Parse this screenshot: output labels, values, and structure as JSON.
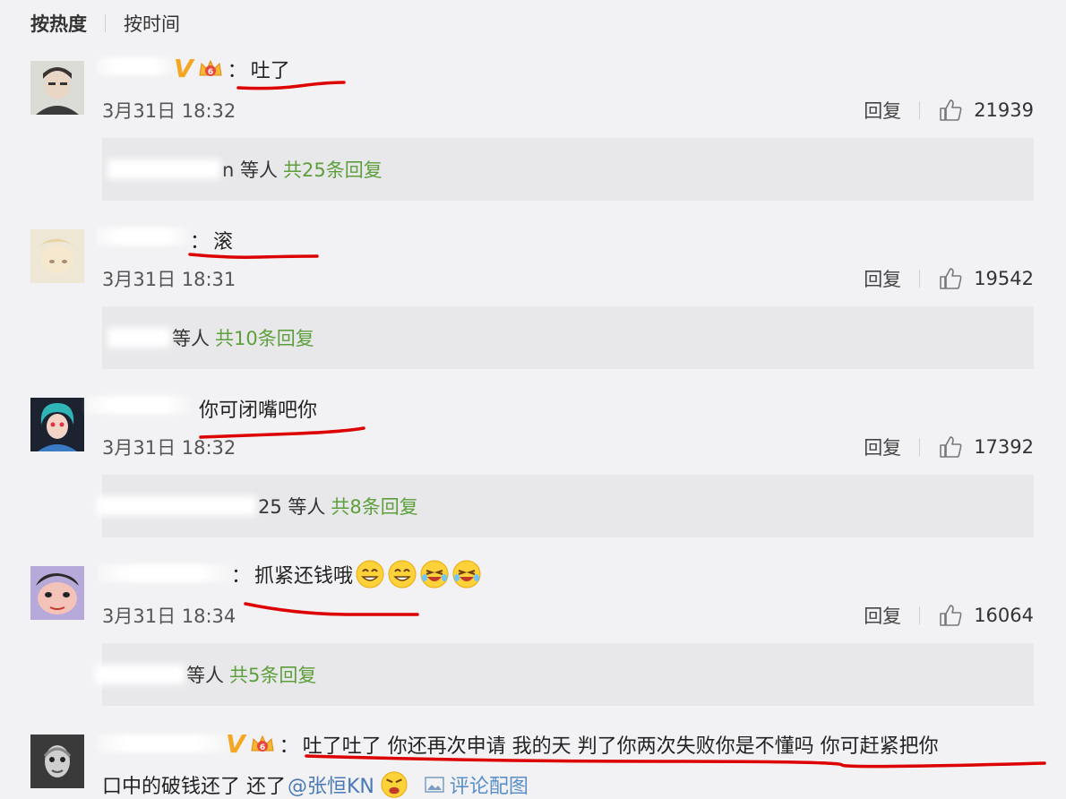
{
  "sort": {
    "hot": "按热度",
    "time": "按时间"
  },
  "actions": {
    "reply": "回复"
  },
  "colors": {
    "background": "#f2f2f4",
    "reply_box": "#e8e8ea",
    "green": "#5d9f3c",
    "red_line": "#dd0000",
    "vip": "#f5a623"
  },
  "comments": [
    {
      "colon": "：",
      "text": "吐了",
      "time": "3月31日 18:32",
      "likes": "21939",
      "reply_prefix": "n 等人",
      "reply_count": "共25条回复"
    },
    {
      "colon": "：",
      "text": "滚",
      "time": "3月31日 18:31",
      "likes": "19542",
      "reply_prefix": "等人",
      "reply_count": "共10条回复"
    },
    {
      "colon": "",
      "text": "你可闭嘴吧你",
      "time": "3月31日 18:32",
      "likes": "17392",
      "reply_prefix": "25 等人",
      "reply_count": "共8条回复"
    },
    {
      "colon": "：",
      "text": "抓紧还钱哦",
      "time": "3月31日 18:34",
      "likes": "16064",
      "reply_prefix": "等人",
      "reply_count": "共5条回复"
    },
    {
      "colon": "：",
      "text": "吐了吐了  你还再次申请  我的天  判了你两次失败你是不懂吗  你可赶紧把你",
      "line2": "口中的破钱还了  还了",
      "mention": "@张恒KN",
      "pic_link": "评论配图"
    }
  ],
  "icons": [
    "thumb-up-icon",
    "vip-v-icon",
    "crown-icon",
    "smile-emoji-icon",
    "angry-emoji-icon",
    "picture-icon"
  ]
}
